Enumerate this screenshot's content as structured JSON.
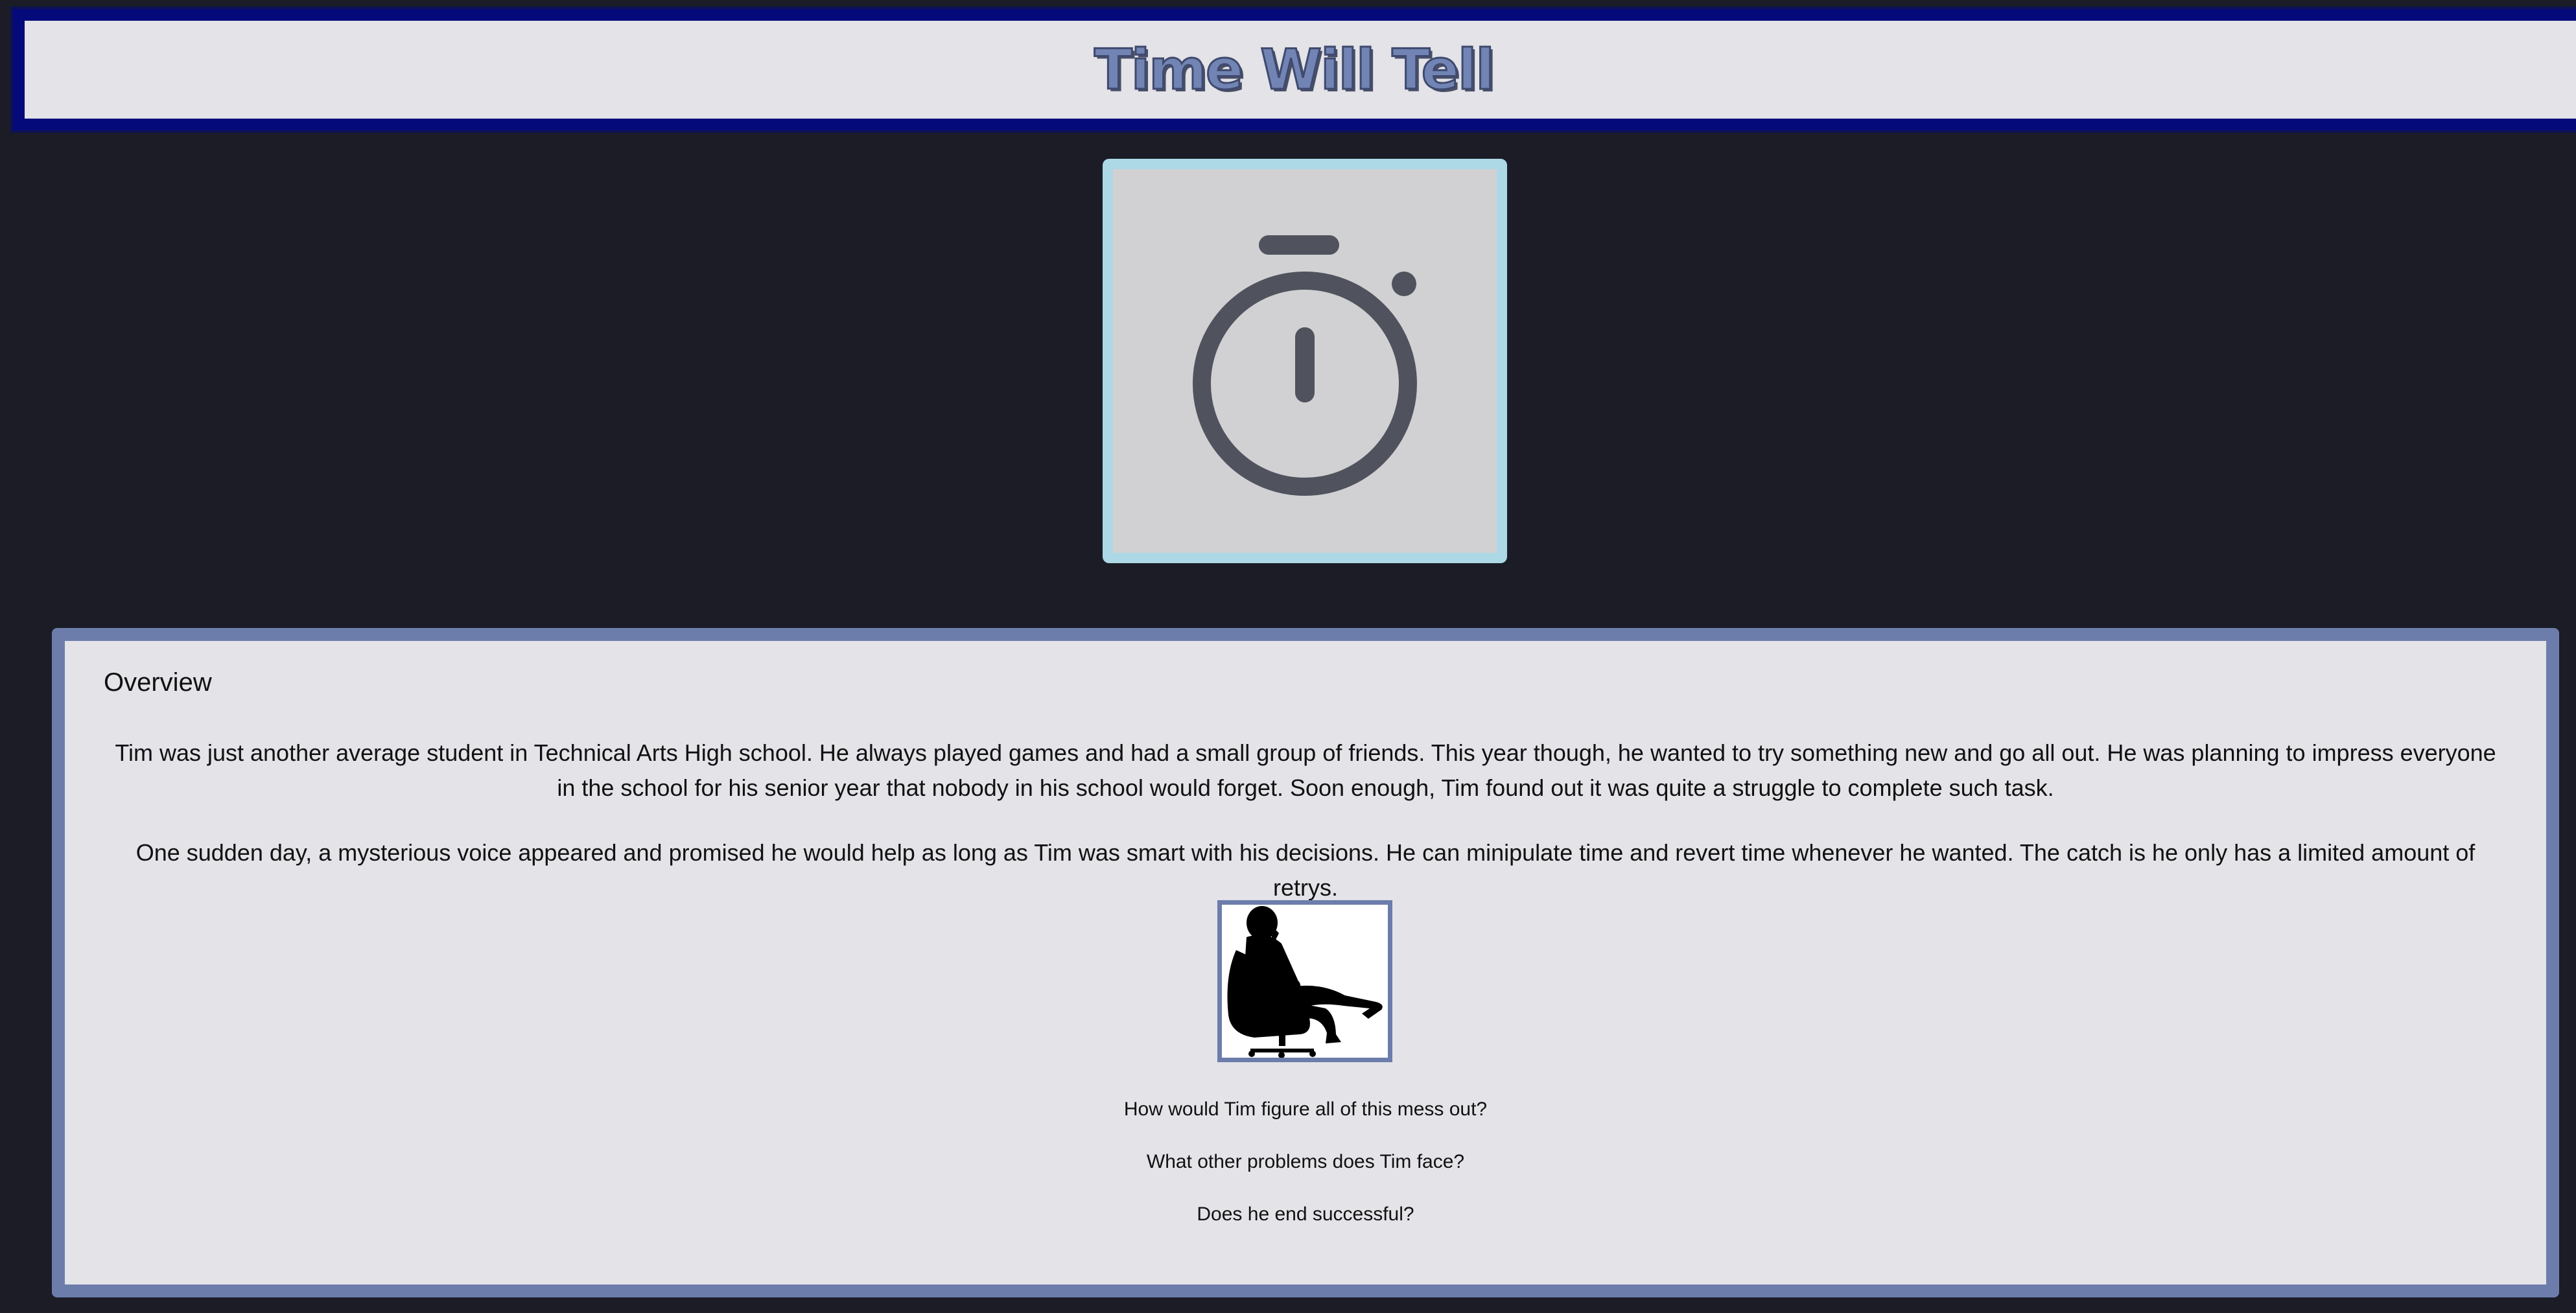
{
  "header": {
    "title": "Time Will Tell",
    "bar_color": "#050a7a",
    "title_color": "#7184b4"
  },
  "hero": {
    "icon": "stopwatch-icon",
    "frame_color": "#add8e6"
  },
  "overview": {
    "heading": "Overview",
    "paragraphs": [
      "Tim was just another average student in Technical Arts High school. He always played games and had a small group of friends. This year though, he wanted to try something new and go all out. He was planning to impress everyone in the school for his senior year that nobody in his school would forget. Soon enough, Tim found out it was quite a struggle to complete such task.",
      "One sudden day, a mysterious voice appeared and promised he would help as long as Tim was smart with his decisions. He can minipulate time and revert time whenever he wanted. The catch is he only has a limited amount of retrys."
    ],
    "image_icon": "thinking-man-silhouette-icon",
    "questions": [
      "How would Tim figure all of this mess out?",
      "What other problems does Tim face?",
      "Does he end successful?"
    ],
    "border_color": "#6d7dab"
  }
}
